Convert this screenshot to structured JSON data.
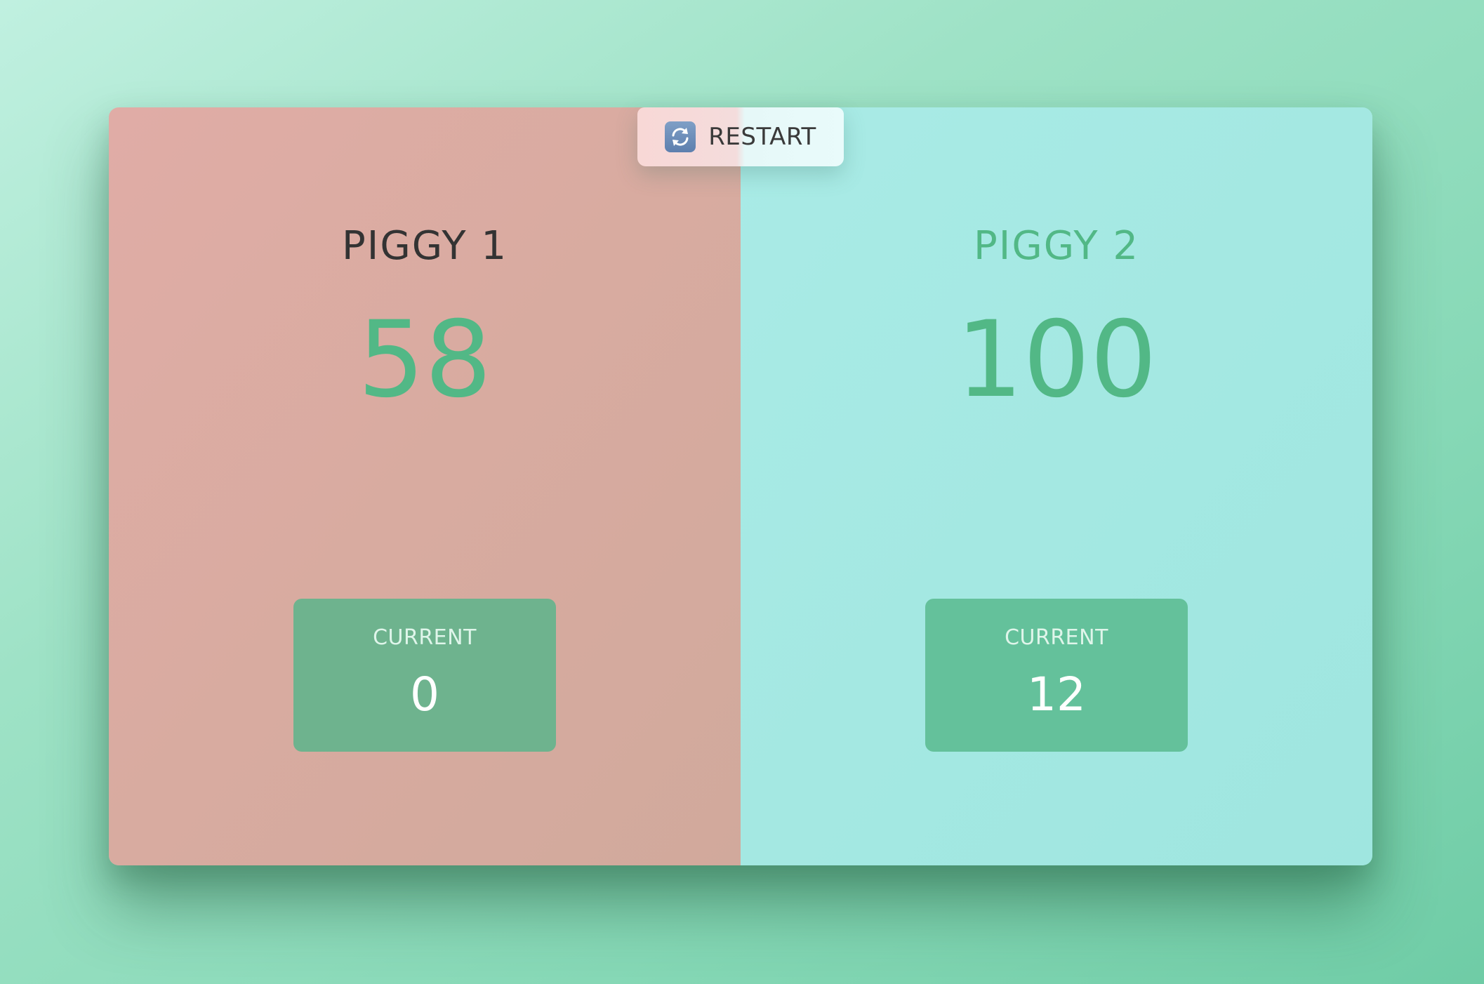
{
  "restart": {
    "label": "RESTART",
    "icon": "refresh-icon"
  },
  "players": [
    {
      "name": "PIGGY 1",
      "score": "58",
      "current_label": "CURRENT",
      "current_score": "0",
      "active": true
    },
    {
      "name": "PIGGY 2",
      "score": "100",
      "current_label": "CURRENT",
      "current_score": "12",
      "active": false
    }
  ],
  "colors": {
    "accent_green": "#52b886",
    "player1_bg": "#dbab a3",
    "player2_bg": "#a6e9e3"
  }
}
